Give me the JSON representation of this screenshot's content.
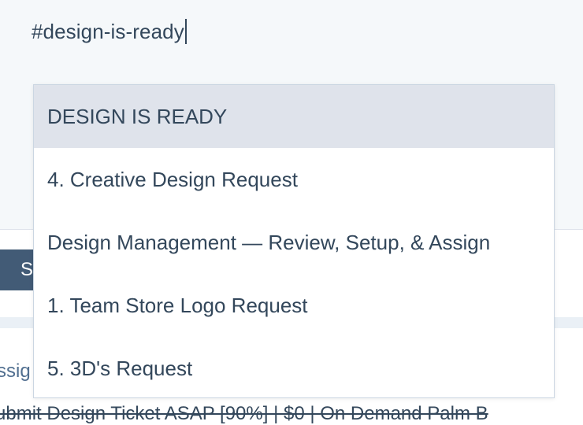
{
  "editor": {
    "text": "#design-is-ready"
  },
  "button": {
    "label": "S"
  },
  "background": {
    "assign_text": "ssig",
    "ticket_text": "ubmit Design Ticket ASAP [90%] | $0 | On Demand Palm B"
  },
  "dropdown": {
    "options": [
      {
        "label": "DESIGN IS READY",
        "highlighted": true
      },
      {
        "label": "4. Creative Design Request",
        "highlighted": false
      },
      {
        "label": "Design Management — Review, Setup, & Assign",
        "highlighted": false
      },
      {
        "label": "1. Team Store Logo Request",
        "highlighted": false
      },
      {
        "label": "5. 3D's Request",
        "highlighted": false
      }
    ]
  },
  "colors": {
    "text": "#33475b",
    "highlight": "#dfe3eb",
    "button": "#425b76",
    "editor_bg": "#f5f8fa"
  }
}
